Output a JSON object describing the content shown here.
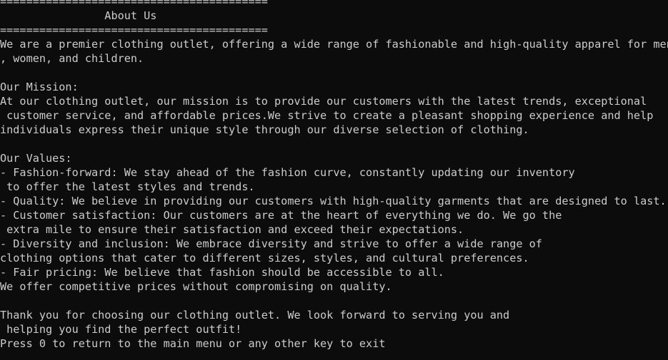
{
  "terminal": {
    "lines": [
      "=========================================",
      "                About Us",
      "=========================================",
      "We are a premier clothing outlet, offering a wide range of fashionable and high-quality apparel for men",
      ", women, and children.",
      "",
      "Our Mission:",
      "At our clothing outlet, our mission is to provide our customers with the latest trends, exceptional",
      " customer service, and affordable prices.We strive to create a pleasant shopping experience and help",
      "individuals express their unique style through our diverse selection of clothing.",
      "",
      "Our Values:",
      "- Fashion-forward: We stay ahead of the fashion curve, constantly updating our inventory",
      " to offer the latest styles and trends.",
      "- Quality: We believe in providing our customers with high-quality garments that are designed to last.",
      "- Customer satisfaction: Our customers are at the heart of everything we do. We go the",
      " extra mile to ensure their satisfaction and exceed their expectations.",
      "- Diversity and inclusion: We embrace diversity and strive to offer a wide range of",
      "clothing options that cater to different sizes, styles, and cultural preferences.",
      "- Fair pricing: We believe that fashion should be accessible to all.",
      "We offer competitive prices without compromising on quality.",
      "",
      "Thank you for choosing our clothing outlet. We look forward to serving you and",
      " helping you find the perfect outfit!",
      "Press 0 to return to the main menu or any other key to exit"
    ]
  }
}
